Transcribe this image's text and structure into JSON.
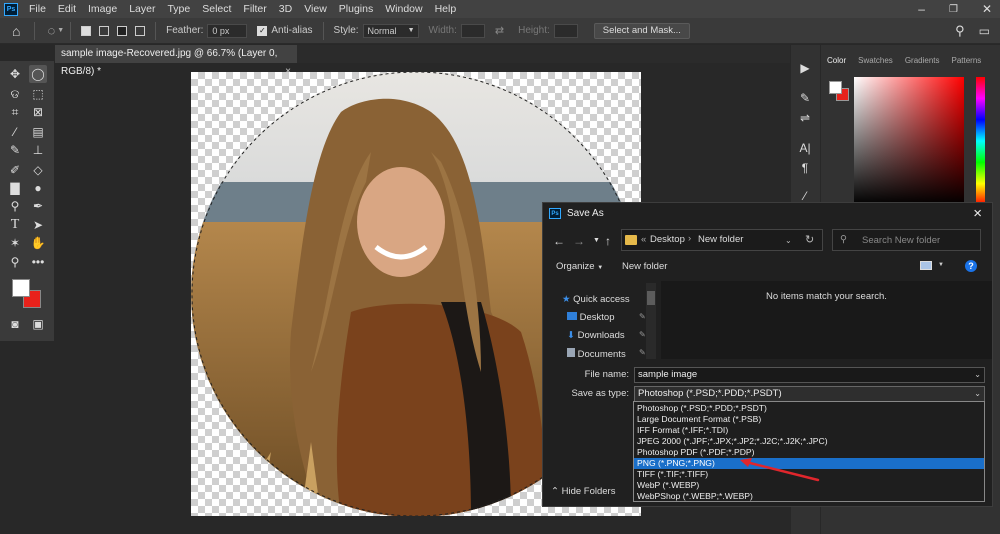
{
  "app": {
    "logo": "Ps",
    "menu": [
      "File",
      "Edit",
      "Image",
      "Layer",
      "Type",
      "Select",
      "Filter",
      "3D",
      "View",
      "Plugins",
      "Window",
      "Help"
    ]
  },
  "options": {
    "feather_label": "Feather:",
    "feather_value": "0 px",
    "antialias_label": "Anti-alias",
    "style_label": "Style:",
    "style_value": "Normal",
    "width_label": "Width:",
    "height_label": "Height:",
    "select_mask_button": "Select and Mask..."
  },
  "document": {
    "tab_title": "sample image-Recovered.jpg @ 66.7% (Layer 0, RGB/8) *",
    "close": "×"
  },
  "color_panel": {
    "tabs": [
      "Color",
      "Swatches",
      "Gradients",
      "Patterns"
    ],
    "active_tab": "Color",
    "foreground": "#ffffff",
    "background": "#e8221b"
  },
  "dialog": {
    "title": "Save As",
    "close": "×",
    "address": {
      "prefix": "«",
      "parts": [
        "Desktop",
        "New folder"
      ],
      "separator": "›"
    },
    "search_placeholder": "Search New folder",
    "organize_label": "Organize",
    "new_folder_label": "New folder",
    "help": "?",
    "nav_items": [
      "Quick access",
      "Desktop",
      "Downloads",
      "Documents"
    ],
    "empty_message": "No items match your search.",
    "file_name_label": "File name:",
    "file_name_value": "sample image",
    "save_type_label": "Save as type:",
    "save_type_value": "Photoshop (*.PSD;*.PDD;*.PSDT)",
    "type_options": [
      "Photoshop (*.PSD;*.PDD;*.PSDT)",
      "Large Document Format (*.PSB)",
      "IFF Format (*.IFF;*.TDI)",
      "JPEG 2000 (*.JPF;*.JPX;*.JP2;*.J2C;*.J2K;*.JPC)",
      "Photoshop PDF (*.PDF;*.PDP)",
      "PNG (*.PNG;*.PNG)",
      "TIFF (*.TIF;*.TIFF)",
      "WebP (*.WEBP)",
      "WebPShop (*.WEBP;*.WEBP)"
    ],
    "highlighted_option": "PNG (*.PNG;*.PNG)",
    "hide_folders_label": "Hide Folders"
  },
  "annotation": {
    "arrow_color": "#e0262c"
  }
}
